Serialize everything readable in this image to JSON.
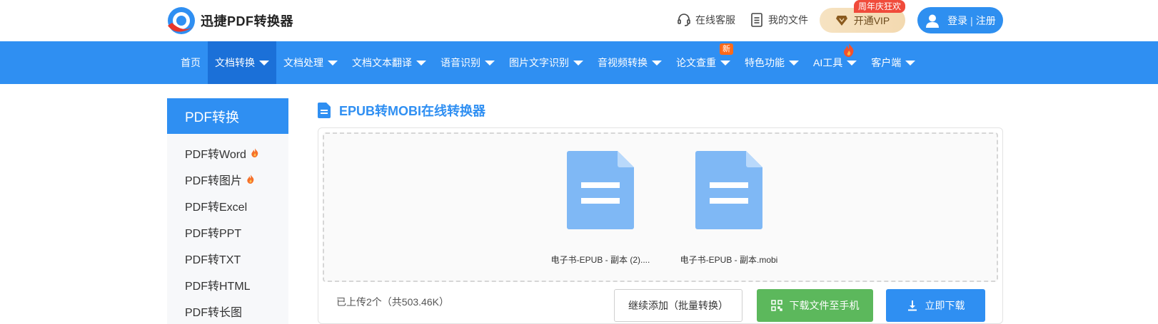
{
  "header": {
    "logo_text": "迅捷PDF转换器",
    "service_label": "在线客服",
    "files_label": "我的文件",
    "vip_label": "开通VIP",
    "vip_badge": "周年庆狂欢",
    "login_label": "登录",
    "register_label": "注册",
    "login_separator": "|"
  },
  "nav": {
    "items": [
      {
        "label": "首页",
        "caret": false
      },
      {
        "label": "文档转换",
        "caret": true,
        "active": true
      },
      {
        "label": "文档处理",
        "caret": true
      },
      {
        "label": "文档文本翻译",
        "caret": true
      },
      {
        "label": "语音识别",
        "caret": true
      },
      {
        "label": "图片文字识别",
        "caret": true
      },
      {
        "label": "音视频转换",
        "caret": true
      },
      {
        "label": "论文查重",
        "caret": true,
        "badge": "新"
      },
      {
        "label": "特色功能",
        "caret": true
      },
      {
        "label": "AI工具",
        "caret": true,
        "icon": "fire-icon"
      },
      {
        "label": "客户端",
        "caret": true
      }
    ]
  },
  "sidebar": {
    "title": "PDF转换",
    "items": [
      {
        "label": "PDF转Word",
        "hot": true
      },
      {
        "label": "PDF转图片",
        "hot": true
      },
      {
        "label": "PDF转Excel",
        "hot": false
      },
      {
        "label": "PDF转PPT",
        "hot": false
      },
      {
        "label": "PDF转TXT",
        "hot": false
      },
      {
        "label": "PDF转HTML",
        "hot": false
      },
      {
        "label": "PDF转长图",
        "hot": false
      }
    ]
  },
  "main": {
    "title": "EPUB转MOBI在线转换器",
    "files": [
      {
        "name": "电子书-EPUB - 副本 (2)....",
        "icon": "document-icon"
      },
      {
        "name": "电子书-EPUB - 副本.mobi",
        "icon": "document-icon"
      }
    ],
    "upload_info": "已上传2个（共503.46K）",
    "add_button": "继续添加（批量转换）",
    "phone_button": "下载文件至手机",
    "download_button": "立即下载"
  },
  "colors": {
    "brand_blue": "#2f8ff2",
    "active_nav": "#1b70d8",
    "green": "#5cb85c",
    "vip_gold": "#f3d9b0",
    "badge_red": "#f04b3b",
    "file_icon": "#7fb8f5"
  }
}
